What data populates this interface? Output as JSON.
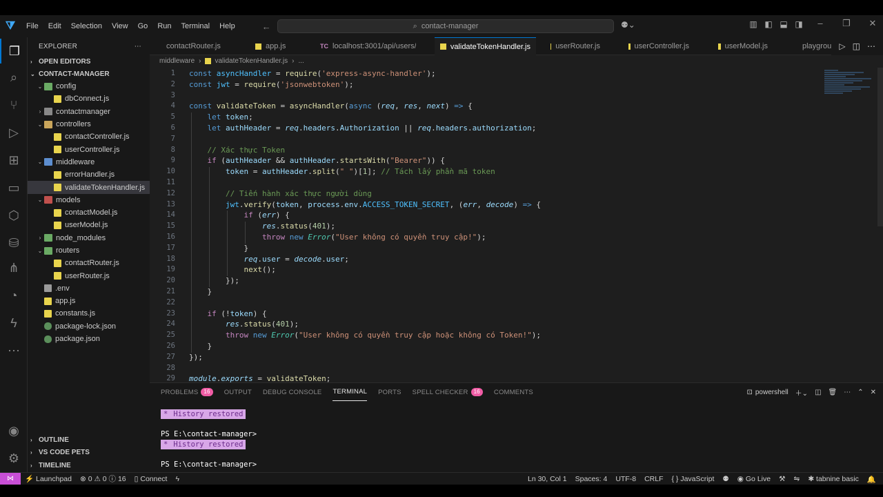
{
  "titlebar": {
    "menu": [
      "File",
      "Edit",
      "Selection",
      "View",
      "Go",
      "Run",
      "Terminal",
      "Help"
    ],
    "search": "contact-manager"
  },
  "explorer": {
    "header": "EXPLORER",
    "open_editors": "OPEN EDITORS",
    "project": "CONTACT-MANAGER",
    "tree": [
      {
        "label": "config",
        "depth": 1,
        "kind": "folder-open",
        "icon": "foldg"
      },
      {
        "label": "dbConnect.js",
        "depth": 2,
        "kind": "file",
        "icon": "js"
      },
      {
        "label": "contactmanager",
        "depth": 1,
        "kind": "folder",
        "icon": "foldgr"
      },
      {
        "label": "controllers",
        "depth": 1,
        "kind": "folder-open",
        "icon": "fold"
      },
      {
        "label": "contactController.js",
        "depth": 2,
        "kind": "file",
        "icon": "js"
      },
      {
        "label": "userController.js",
        "depth": 2,
        "kind": "file",
        "icon": "js"
      },
      {
        "label": "middleware",
        "depth": 1,
        "kind": "folder-open",
        "icon": "foldb"
      },
      {
        "label": "errorHandler.js",
        "depth": 2,
        "kind": "file",
        "icon": "js"
      },
      {
        "label": "validateTokenHandler.js",
        "depth": 2,
        "kind": "file",
        "icon": "js",
        "selected": true
      },
      {
        "label": "models",
        "depth": 1,
        "kind": "folder-open",
        "icon": "foldr"
      },
      {
        "label": "contactModel.js",
        "depth": 2,
        "kind": "file",
        "icon": "js"
      },
      {
        "label": "userModel.js",
        "depth": 2,
        "kind": "file",
        "icon": "js"
      },
      {
        "label": "node_modules",
        "depth": 1,
        "kind": "folder",
        "icon": "foldg"
      },
      {
        "label": "routers",
        "depth": 1,
        "kind": "folder-open",
        "icon": "foldg"
      },
      {
        "label": "contactRouter.js",
        "depth": 2,
        "kind": "file",
        "icon": "js"
      },
      {
        "label": "userRouter.js",
        "depth": 2,
        "kind": "file",
        "icon": "js"
      },
      {
        "label": ".env",
        "depth": 1,
        "kind": "file",
        "icon": "env"
      },
      {
        "label": "app.js",
        "depth": 1,
        "kind": "file",
        "icon": "js"
      },
      {
        "label": "constants.js",
        "depth": 1,
        "kind": "file",
        "icon": "js"
      },
      {
        "label": "package-lock.json",
        "depth": 1,
        "kind": "file",
        "icon": "json"
      },
      {
        "label": "package.json",
        "depth": 1,
        "kind": "file",
        "icon": "json"
      }
    ],
    "footer": [
      "OUTLINE",
      "VS CODE PETS",
      "TIMELINE"
    ]
  },
  "tabs": [
    {
      "label": "contactRouter.js",
      "icon": "js"
    },
    {
      "label": "app.js",
      "icon": "js"
    },
    {
      "label": "localhost:3001/api/users/...",
      "icon": "tc"
    },
    {
      "label": "validateTokenHandler.js",
      "icon": "js",
      "active": true
    },
    {
      "label": "userRouter.js",
      "icon": "js"
    },
    {
      "label": "userController.js",
      "icon": "js"
    },
    {
      "label": "userModel.js",
      "icon": "js"
    },
    {
      "label": "playgrou",
      "icon": "js"
    }
  ],
  "tc_icon_text": "TC",
  "breadcrumb": [
    "middleware",
    "validateTokenHandler.js",
    "..."
  ],
  "code_lines": [
    [
      [
        "k",
        "const"
      ],
      [
        "pu",
        " "
      ],
      [
        "cn",
        "asyncHandler"
      ],
      [
        "pu",
        " = "
      ],
      [
        "f",
        "require"
      ],
      [
        "pu",
        "("
      ],
      [
        "s",
        "'express-async-handler'"
      ],
      [
        "pu",
        ");"
      ]
    ],
    [
      [
        "k",
        "const"
      ],
      [
        "pu",
        " "
      ],
      [
        "cn",
        "jwt"
      ],
      [
        "pu",
        " = "
      ],
      [
        "f",
        "require"
      ],
      [
        "pu",
        "("
      ],
      [
        "s",
        "'jsonwebtoken'"
      ],
      [
        "pu",
        ");"
      ]
    ],
    [],
    [
      [
        "k",
        "const"
      ],
      [
        "pu",
        " "
      ],
      [
        "f",
        "validateToken"
      ],
      [
        "pu",
        " = "
      ],
      [
        "f",
        "asyncHandler"
      ],
      [
        "pu",
        "("
      ],
      [
        "k",
        "async"
      ],
      [
        "pu",
        " ("
      ],
      [
        "p",
        "req"
      ],
      [
        "pu",
        ", "
      ],
      [
        "p",
        "res"
      ],
      [
        "pu",
        ", "
      ],
      [
        "p",
        "next"
      ],
      [
        "pu",
        ") "
      ],
      [
        "k",
        "=>"
      ],
      [
        "pu",
        " {"
      ]
    ],
    [
      [
        "pu",
        "    "
      ],
      [
        "k",
        "let"
      ],
      [
        "pu",
        " "
      ],
      [
        "v",
        "token"
      ],
      [
        "pu",
        ";"
      ]
    ],
    [
      [
        "pu",
        "    "
      ],
      [
        "k",
        "let"
      ],
      [
        "pu",
        " "
      ],
      [
        "v",
        "authHeader"
      ],
      [
        "pu",
        " = "
      ],
      [
        "p",
        "req"
      ],
      [
        "pu",
        "."
      ],
      [
        "v",
        "headers"
      ],
      [
        "pu",
        "."
      ],
      [
        "v",
        "Authorization"
      ],
      [
        "pu",
        " || "
      ],
      [
        "p",
        "req"
      ],
      [
        "pu",
        "."
      ],
      [
        "v",
        "headers"
      ],
      [
        "pu",
        "."
      ],
      [
        "v",
        "authorization"
      ],
      [
        "pu",
        ";"
      ]
    ],
    [],
    [
      [
        "pu",
        "    "
      ],
      [
        "cm",
        "// Xác thực Token"
      ]
    ],
    [
      [
        "pu",
        "    "
      ],
      [
        "kc",
        "if"
      ],
      [
        "pu",
        " ("
      ],
      [
        "v",
        "authHeader"
      ],
      [
        "pu",
        " && "
      ],
      [
        "v",
        "authHeader"
      ],
      [
        "pu",
        "."
      ],
      [
        "f",
        "startsWith"
      ],
      [
        "pu",
        "("
      ],
      [
        "s",
        "\"Bearer\""
      ],
      [
        "pu",
        ")) {"
      ]
    ],
    [
      [
        "pu",
        "        "
      ],
      [
        "v",
        "token"
      ],
      [
        "pu",
        " = "
      ],
      [
        "v",
        "authHeader"
      ],
      [
        "pu",
        "."
      ],
      [
        "f",
        "split"
      ],
      [
        "pu",
        "("
      ],
      [
        "s",
        "\" \""
      ],
      [
        "pu",
        ")["
      ],
      [
        "n",
        "1"
      ],
      [
        "pu",
        "]; "
      ],
      [
        "cm",
        "// Tách lấy phần mã token"
      ]
    ],
    [],
    [
      [
        "pu",
        "        "
      ],
      [
        "cm",
        "// Tiến hành xác thực người dùng"
      ]
    ],
    [
      [
        "pu",
        "        "
      ],
      [
        "cn",
        "jwt"
      ],
      [
        "pu",
        "."
      ],
      [
        "f",
        "verify"
      ],
      [
        "pu",
        "("
      ],
      [
        "v",
        "token"
      ],
      [
        "pu",
        ", "
      ],
      [
        "v",
        "process"
      ],
      [
        "pu",
        "."
      ],
      [
        "v",
        "env"
      ],
      [
        "pu",
        "."
      ],
      [
        "cn",
        "ACCESS_TOKEN_SECRET"
      ],
      [
        "pu",
        ", ("
      ],
      [
        "p",
        "err"
      ],
      [
        "pu",
        ", "
      ],
      [
        "p",
        "decode"
      ],
      [
        "pu",
        ") "
      ],
      [
        "k",
        "=>"
      ],
      [
        "pu",
        " {"
      ]
    ],
    [
      [
        "pu",
        "            "
      ],
      [
        "kc",
        "if"
      ],
      [
        "pu",
        " ("
      ],
      [
        "p",
        "err"
      ],
      [
        "pu",
        ") {"
      ]
    ],
    [
      [
        "pu",
        "                "
      ],
      [
        "p",
        "res"
      ],
      [
        "pu",
        "."
      ],
      [
        "f",
        "status"
      ],
      [
        "pu",
        "("
      ],
      [
        "n",
        "401"
      ],
      [
        "pu",
        ");"
      ]
    ],
    [
      [
        "pu",
        "                "
      ],
      [
        "kc",
        "throw"
      ],
      [
        "pu",
        " "
      ],
      [
        "k",
        "new"
      ],
      [
        "pu",
        " "
      ],
      [
        "t",
        "Error"
      ],
      [
        "pu",
        "("
      ],
      [
        "s",
        "\"User không có quyền truy cập!\""
      ],
      [
        "pu",
        ");"
      ]
    ],
    [
      [
        "pu",
        "            }"
      ]
    ],
    [
      [
        "pu",
        "            "
      ],
      [
        "p",
        "req"
      ],
      [
        "pu",
        "."
      ],
      [
        "v",
        "user"
      ],
      [
        "pu",
        " = "
      ],
      [
        "p",
        "decode"
      ],
      [
        "pu",
        "."
      ],
      [
        "v",
        "user"
      ],
      [
        "pu",
        ";"
      ]
    ],
    [
      [
        "pu",
        "            "
      ],
      [
        "f",
        "next"
      ],
      [
        "pu",
        "();"
      ]
    ],
    [
      [
        "pu",
        "        });"
      ]
    ],
    [
      [
        "pu",
        "    }"
      ]
    ],
    [],
    [
      [
        "pu",
        "    "
      ],
      [
        "kc",
        "if"
      ],
      [
        "pu",
        " (!"
      ],
      [
        "v",
        "token"
      ],
      [
        "pu",
        ") {"
      ]
    ],
    [
      [
        "pu",
        "        "
      ],
      [
        "p",
        "res"
      ],
      [
        "pu",
        "."
      ],
      [
        "f",
        "status"
      ],
      [
        "pu",
        "("
      ],
      [
        "n",
        "401"
      ],
      [
        "pu",
        ");"
      ]
    ],
    [
      [
        "pu",
        "        "
      ],
      [
        "kc",
        "throw"
      ],
      [
        "pu",
        " "
      ],
      [
        "k",
        "new"
      ],
      [
        "pu",
        " "
      ],
      [
        "t",
        "Error"
      ],
      [
        "pu",
        "("
      ],
      [
        "s",
        "\"User không có quyền truy cập hoặc không có Token!\""
      ],
      [
        "pu",
        ");"
      ]
    ],
    [
      [
        "pu",
        "    }"
      ]
    ],
    [
      [
        "pu",
        "});"
      ]
    ],
    [],
    [
      [
        "p",
        "module"
      ],
      [
        "pu",
        "."
      ],
      [
        "p",
        "exports"
      ],
      [
        "pu",
        " = "
      ],
      [
        "f",
        "validateToken"
      ],
      [
        "pu",
        ";"
      ]
    ]
  ],
  "panel": {
    "tabs": [
      {
        "label": "PROBLEMS",
        "badge": "16"
      },
      {
        "label": "OUTPUT"
      },
      {
        "label": "DEBUG CONSOLE"
      },
      {
        "label": "TERMINAL",
        "active": true
      },
      {
        "label": "PORTS"
      },
      {
        "label": "SPELL CHECKER",
        "badge": "16"
      },
      {
        "label": "COMMENTS"
      }
    ],
    "shell": "powershell",
    "terminal_lines": [
      {
        "type": "hist",
        "text": "History restored"
      },
      {
        "type": "blank",
        "text": ""
      },
      {
        "type": "prompt",
        "text": "PS E:\\contact-manager>"
      },
      {
        "type": "hist",
        "text": "History restored"
      },
      {
        "type": "blank",
        "text": ""
      },
      {
        "type": "prompt",
        "text": "PS E:\\contact-manager>"
      }
    ],
    "hist_marker": "*"
  },
  "statusbar": {
    "launchpad": "Launchpad",
    "errors": "0",
    "warnings": "0",
    "infos": "16",
    "connect": "Connect",
    "position": "Ln 30, Col 1",
    "spaces": "Spaces: 4",
    "encoding": "UTF-8",
    "eol": "CRLF",
    "language": "JavaScript",
    "golive": "Go Live",
    "tabnine": "tabnine basic"
  },
  "colors": {
    "accent": "#0078d4",
    "remote": "#c84fd6",
    "badge": "#f05ca5"
  }
}
